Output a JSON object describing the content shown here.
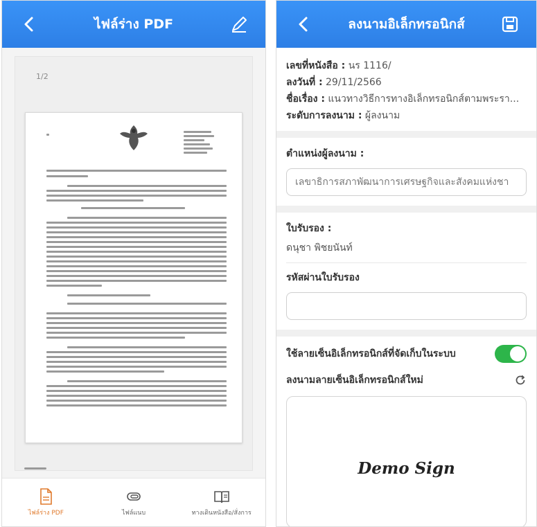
{
  "left_screen": {
    "title": "ไฟล์ร่าง PDF",
    "page_indicator": "1/2",
    "nav": [
      {
        "label": "ไฟล์ร่าง PDF",
        "icon": "pdf-file-icon",
        "active": true
      },
      {
        "label": "ไฟล์แนบ",
        "icon": "paperclip-icon",
        "active": false
      },
      {
        "label": "ทางเดินหนังสือ/สั่งการ",
        "icon": "book-icon",
        "active": false
      }
    ]
  },
  "right_screen": {
    "title": "ลงนามอิเล็กทรอนิกส์",
    "doc_info": {
      "number_label": "เลขที่หนังสือ :",
      "number_value": "นร 1116/",
      "date_label": "ลงวันที่ :",
      "date_value": "29/11/2566",
      "subject_label": "ชื่อเรื่อง :",
      "subject_value": "แนวทางวิธีการทางอิเล็กทรอนิกส์ตามพระรา...",
      "level_label": "ระดับการลงนาม :",
      "level_value": "ผู้ลงนาม"
    },
    "signer_position_label": "ตำแหน่งผู้ลงนาม :",
    "signer_position_value": "เลขาธิการสภาพัฒนาการเศรษฐกิจและสังคมแห่งชา",
    "certificate_label": "ใบรับรอง :",
    "certificate_value": "ดนุชา พิชยนันท์",
    "certificate_password_label": "รหัสผ่านใบรับรอง",
    "certificate_password_value": "",
    "use_stored_signature_label": "ใช้ลายเซ็นอิเล็กทรอนิกส์ที่จัดเก็บในระบบ",
    "use_stored_signature_on": true,
    "new_signature_label": "ลงนามลายเซ็นอิเล็กทรอนิกส์ใหม่",
    "signature_text": "Demo Sign"
  },
  "colors": {
    "header": "#2d7fe6",
    "toggle_on": "#2db54a",
    "nav_active": "#e07a2c"
  }
}
